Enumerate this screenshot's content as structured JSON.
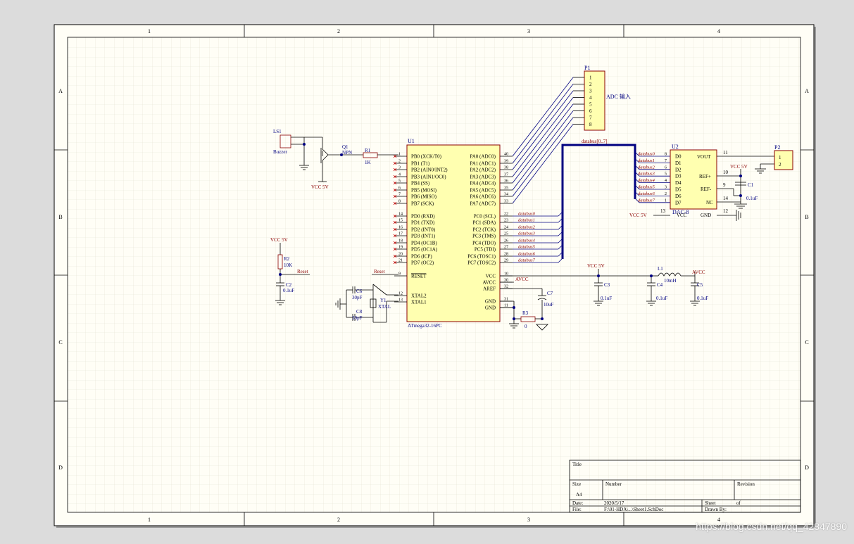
{
  "frame": {
    "cols": [
      "1",
      "2",
      "3",
      "4"
    ],
    "rows": [
      "A",
      "B",
      "C",
      "D"
    ]
  },
  "titleblock": {
    "title_label": "Title",
    "size_label": "Size",
    "size_value": "A4",
    "number_label": "Number",
    "revision_label": "Revision",
    "date_label": "Date:",
    "date_value": "2020/5/17",
    "sheet_label": "Sheet",
    "of_label": "of",
    "file_label": "File:",
    "file_value": "F:\\01-HDA\\...\\Sheet1.SchDoc",
    "drawnby_label": "Drawn By:"
  },
  "mcu": {
    "ref": "U1",
    "part": "ATmega32-16PC",
    "left_pins": [
      {
        "num": "1",
        "name": "PB0 (XCK/T0)"
      },
      {
        "num": "2",
        "name": "PB1 (T1)"
      },
      {
        "num": "3",
        "name": "PB2 (AIN0/INT2)"
      },
      {
        "num": "4",
        "name": "PB3 (AIN1/OC0)"
      },
      {
        "num": "5",
        "name": "PB4 (SS)"
      },
      {
        "num": "6",
        "name": "PB5 (MOSI)"
      },
      {
        "num": "7",
        "name": "PB6 (MISO)"
      },
      {
        "num": "8",
        "name": "PB7 (SCK)"
      },
      {
        "num": "14",
        "name": "PD0 (RXD)"
      },
      {
        "num": "15",
        "name": "PD1 (TXD)"
      },
      {
        "num": "16",
        "name": "PD2 (INT0)"
      },
      {
        "num": "17",
        "name": "PD3 (INT1)"
      },
      {
        "num": "18",
        "name": "PD4 (OC1B)"
      },
      {
        "num": "19",
        "name": "PD5 (OC1A)"
      },
      {
        "num": "20",
        "name": "PD6 (ICP)"
      },
      {
        "num": "21",
        "name": "PD7 (OC2)"
      },
      {
        "num": "9",
        "name": "RESET"
      },
      {
        "num": "12",
        "name": "XTAL2"
      },
      {
        "num": "13",
        "name": "XTAL1"
      }
    ],
    "right_pins": [
      {
        "num": "40",
        "name": "PA0 (ADC0)"
      },
      {
        "num": "39",
        "name": "PA1 (ADC1)"
      },
      {
        "num": "38",
        "name": "PA2 (ADC2)"
      },
      {
        "num": "37",
        "name": "PA3 (ADC3)"
      },
      {
        "num": "36",
        "name": "PA4 (ADC4)"
      },
      {
        "num": "35",
        "name": "PA5 (ADC5)"
      },
      {
        "num": "34",
        "name": "PA6 (ADC6)"
      },
      {
        "num": "33",
        "name": "PA7 (ADC7)"
      },
      {
        "num": "22",
        "name": "PC0 (SCL)"
      },
      {
        "num": "23",
        "name": "PC1 (SDA)"
      },
      {
        "num": "24",
        "name": "PC2 (TCK)"
      },
      {
        "num": "25",
        "name": "PC3 (TMS)"
      },
      {
        "num": "26",
        "name": "PC4 (TDO)"
      },
      {
        "num": "27",
        "name": "PC5 (TDI)"
      },
      {
        "num": "28",
        "name": "PC6 (TOSC1)"
      },
      {
        "num": "29",
        "name": "PC7 (TOSC2)"
      },
      {
        "num": "10",
        "name": "VCC"
      },
      {
        "num": "30",
        "name": "AVCC"
      },
      {
        "num": "32",
        "name": "AREF"
      },
      {
        "num": "31",
        "name": "GND"
      },
      {
        "num": "11",
        "name": "GND"
      }
    ]
  },
  "bus": {
    "label": "databus[0..7]",
    "nets": [
      "databus0",
      "databus1",
      "databus2",
      "databus3",
      "databus4",
      "databus5",
      "databus6",
      "databus7"
    ]
  },
  "dac": {
    "ref": "U2",
    "part": "DAC-8",
    "inputs": [
      "D0",
      "D1",
      "D2",
      "D3",
      "D4",
      "D5",
      "D6",
      "D7"
    ],
    "input_nums": [
      "8",
      "7",
      "6",
      "5",
      "4",
      "3",
      "2",
      "1"
    ],
    "vout": "VOUT",
    "vout_num": "11",
    "refp": "REF+",
    "refp_num": "10",
    "refm": "REF-",
    "refm_num": "9",
    "nc": "NC",
    "nc_num": "14",
    "vcc": "VCC",
    "vcc_num": "13",
    "gnd": "GND",
    "gnd_num": "12"
  },
  "p1": {
    "ref": "P1",
    "pins": [
      "1",
      "2",
      "3",
      "4",
      "5",
      "6",
      "7",
      "8"
    ],
    "note": "ADC 输入"
  },
  "p2": {
    "ref": "P2",
    "pins": [
      "1",
      "2"
    ]
  },
  "parts": {
    "ls1": "LS1",
    "buzzer": "Buzzer",
    "q1": "Q1",
    "npn": "NPN",
    "r1": "R1",
    "r1v": "1K",
    "r2": "R2",
    "r2v": "10K",
    "r3": "R3",
    "r3v": "0",
    "c1": "C1",
    "c1v": "0.1uF",
    "c2": "C2",
    "c2v": "0.1uF",
    "c3": "C3",
    "c3v": "0.1uF",
    "c4": "C4",
    "c4v": "0.1uF",
    "c5": "C5",
    "c5v": "0.1uF",
    "c6": "C6",
    "c6v": "30pF",
    "c7": "C7",
    "c7v": "10uF",
    "c8": "C8",
    "c8v": "30pF",
    "y1": "Y1",
    "xtal": "XTAL",
    "l1": "L1",
    "l1v": "10mH"
  },
  "nets": {
    "vcc5": "VCC 5V",
    "avcc": "AVCC",
    "reset": "Reset",
    "mcu_avcc": "AVCC"
  },
  "watermark": "https://blog.csdn.net/qq_42847890"
}
